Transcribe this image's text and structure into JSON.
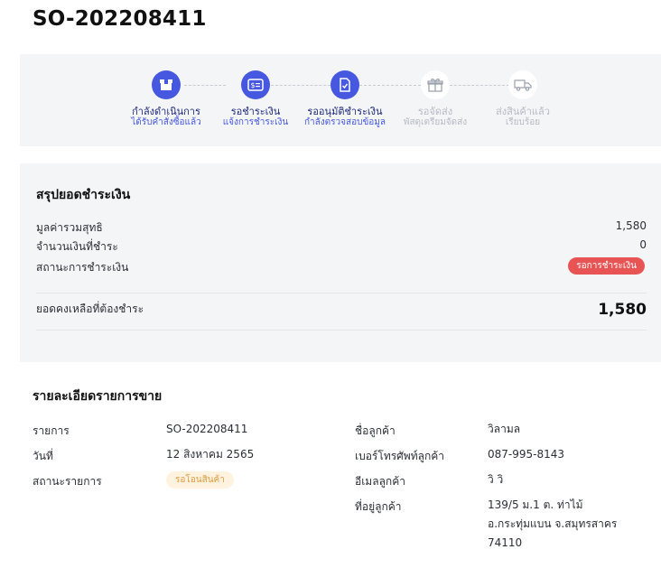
{
  "order": {
    "number": "SO-202208411"
  },
  "steps": [
    {
      "label": "กำลังดำเนินการ",
      "sub": "ได้รับคำสั่งซื้อแล้ว",
      "icon": "box-icon",
      "state": "done"
    },
    {
      "label": "รอชำระเงิน",
      "sub": "แจ้งการชำระเงิน",
      "icon": "dollar-card-icon",
      "state": "done"
    },
    {
      "label": "รออนุมัติชำระเงิน",
      "sub": "กำลังตรวจสอบข้อมูล",
      "icon": "document-check-icon",
      "state": "done"
    },
    {
      "label": "รอจัดส่ง",
      "sub": "พัสดุเตรียมจัดส่ง",
      "icon": "gift-box-icon",
      "state": "pending"
    },
    {
      "label": "ส่งสินค้าแล้ว",
      "sub": "เรียบร้อย",
      "icon": "truck-icon",
      "state": "pending"
    }
  ],
  "summary": {
    "title": "สรุปยอดชำระเงิน",
    "net_total_label": "มูลค่ารวมสุทธิ",
    "net_total": "1,580",
    "paid_label": "จำนวนเงินที่ชำระ",
    "paid": "0",
    "payment_status_label": "สถานะการชำระเงิน",
    "payment_status": "รอการชำระเงิน",
    "balance_label": "ยอดคงเหลือที่ต้องชำระ",
    "balance": "1,580"
  },
  "details": {
    "title": "รายละเอียดรายการขาย",
    "item_label": "รายการ",
    "item": "SO-202208411",
    "date_label": "วันที่",
    "date": "12 สิงหาคม 2565",
    "status_label": "สถานะรายการ",
    "status": "รอโอนสินค้า",
    "customer_name_label": "ชื่อลูกค้า",
    "customer_name": "วิลามล",
    "phone_label": "เบอร์โทรศัพท์ลูกค้า",
    "phone": "087-995-8143",
    "email_label": "อีเมลลูกค้า",
    "email": "วิ วิ",
    "address_label": "ที่อยู่ลูกค้า",
    "address_line1": "139/5 ม.1 ต. ท่าไม้",
    "address_line2": "อ.กระทุ่มแบน จ.สมุทรสาคร",
    "address_line3": "74110"
  },
  "colors": {
    "accent": "#4658e0",
    "danger": "#e85454",
    "warning": "#e09a3e",
    "panel": "#f4f5f7"
  }
}
